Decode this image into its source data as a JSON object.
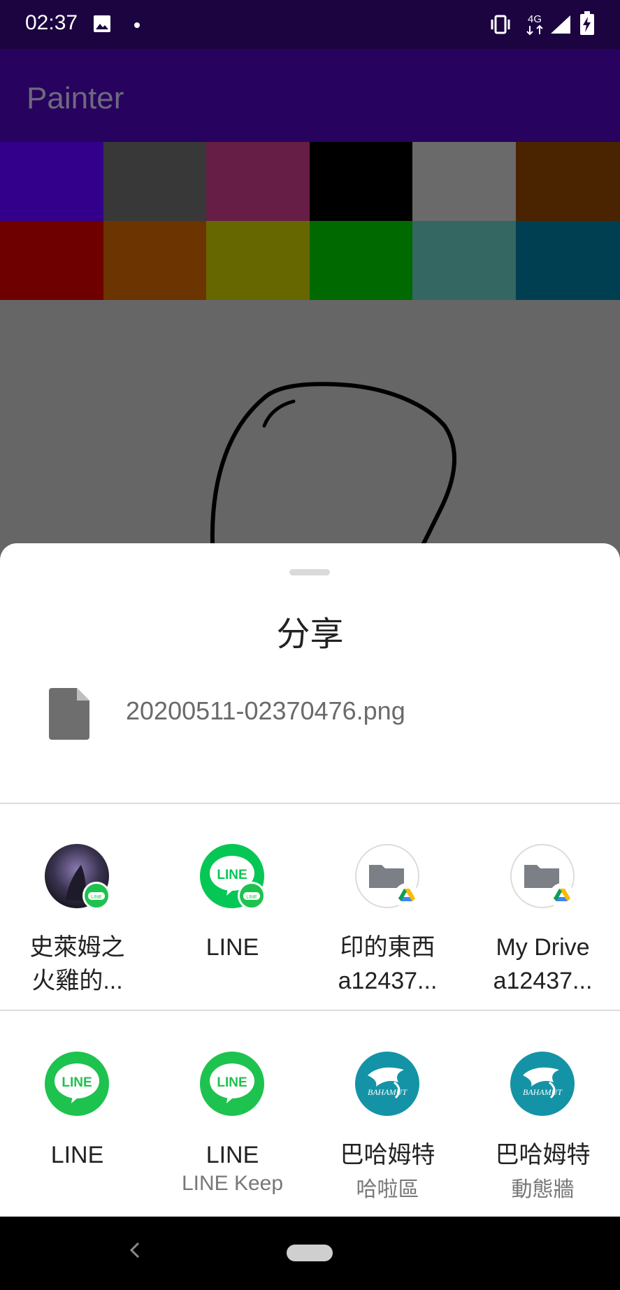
{
  "status_bar": {
    "time": "02:37",
    "network": "4G",
    "icons": [
      "image-icon",
      "dot-icon",
      "vibrate-icon",
      "network-4g-icon",
      "signal-icon",
      "battery-charging-icon"
    ]
  },
  "app": {
    "title": "Painter"
  },
  "palette": {
    "colors": [
      "#32008a",
      "#383838",
      "#661e46",
      "#000000",
      "#6a6a6a",
      "#4a2300",
      "#6e0000",
      "#6b3400",
      "#676700",
      "#006a00",
      "#346662",
      "#003f52"
    ]
  },
  "share_sheet": {
    "title": "分享",
    "file_name": "20200511-02370476.png",
    "direct_targets": [
      {
        "label": "史萊姆之\n火雞的...",
        "icon": "contact-avatar-line-icon"
      },
      {
        "label": "LINE",
        "icon": "line-chat-icon"
      },
      {
        "label": "印的東西\na12437...",
        "icon": "drive-folder-icon"
      },
      {
        "label": "My Drive\na12437...",
        "icon": "drive-folder-icon"
      }
    ],
    "app_targets": [
      {
        "label": "LINE",
        "sublabel": "",
        "icon": "line-icon"
      },
      {
        "label": "LINE",
        "sublabel": "LINE Keep",
        "icon": "line-icon"
      },
      {
        "label": "巴哈姆特",
        "sublabel": "哈啦區",
        "icon": "bahamut-icon"
      },
      {
        "label": "巴哈姆特",
        "sublabel": "動態牆",
        "icon": "bahamut-icon"
      }
    ]
  },
  "nav_bar": {
    "icons": [
      "back-icon",
      "home-pill"
    ]
  }
}
